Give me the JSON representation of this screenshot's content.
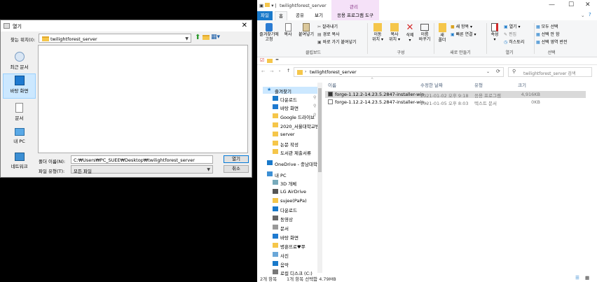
{
  "dialog": {
    "title": "열기",
    "look_in_label": "찾는 위치(I):",
    "look_in_value": "twilightforest_server",
    "places": [
      "최근 문서",
      "바탕 화면",
      "문서",
      "내 PC",
      "네트워크"
    ],
    "filename_label": "폴더 이름(N):",
    "filename_value": "C:₩Users₩PC_SUEE₩Desktop₩twilightforest_server",
    "filetype_label": "파일 유형(T):",
    "filetype_value": "모든 파일",
    "open_button": "열기",
    "cancel_button": "취소"
  },
  "explorer": {
    "title": "twilightforest_server",
    "manage_tab": "관리",
    "tabs": [
      "파일",
      "홈",
      "공유",
      "보기",
      "응용 프로그램 도구"
    ],
    "ribbon": {
      "clipboard": {
        "pin": "즐겨찾기에\n고정",
        "copy": "복사",
        "paste": "붙여넣기",
        "cut": "잘라내기",
        "copy_path": "경로 복사",
        "paste_shortcut": "바로 가기 붙여넣기",
        "group": "클립보드"
      },
      "organize": {
        "move": "이동\n위치 ▾",
        "copy_to": "복사\n위치 ▾",
        "delete": "삭제\n▾",
        "rename": "이름\n바꾸기",
        "group": "구성"
      },
      "new": {
        "folder": "새\n폴더",
        "new_item": "새 항목 ▾",
        "quick_access": "빠른 연결 ▾",
        "group": "새로 만들기"
      },
      "open": {
        "properties": "속성\n▾",
        "open": "열기 ▾",
        "edit": "편집",
        "history": "히스토리",
        "group": "열기"
      },
      "select": {
        "select_all": "모두 선택",
        "select_none": "선택 안 함",
        "invert": "선택 영역 반전",
        "group": "선택"
      }
    },
    "address": "twilightforest_server",
    "search_placeholder": "twilightforest_server 검색",
    "columns": [
      "이름",
      "수정한 날짜",
      "유형",
      "크기"
    ],
    "files": [
      {
        "name": "forge-1.12.2-14.23.5.2847-installer-win",
        "date": "2021-01-02 오후 9:18",
        "type": "응용 프로그램",
        "size": "4,916KB",
        "selected": true
      },
      {
        "name": "forge-1.12.2-14.23.5.2847-installer-win...",
        "date": "2021-01-05 오후 8:03",
        "type": "텍스트 문서",
        "size": "0KB",
        "selected": false
      }
    ],
    "sidebar": [
      {
        "label": "즐겨찾기",
        "kind": "star"
      },
      {
        "label": "다운로드",
        "kind": "down",
        "pin": true
      },
      {
        "label": "바탕 화면",
        "kind": "desk",
        "pin": true
      },
      {
        "label": "Google 드라이브",
        "kind": "folder",
        "pin": true
      },
      {
        "label": "2020_서울대학교병",
        "kind": "folder"
      },
      {
        "label": "server",
        "kind": "folder"
      },
      {
        "label": "논문 작성",
        "kind": "folder"
      },
      {
        "label": "도서관 제출서류",
        "kind": "folder"
      },
      {
        "label": "OneDrive - 충남대학교",
        "kind": "cloud"
      },
      {
        "label": "내 PC",
        "kind": "pc"
      },
      {
        "label": "3D 개체",
        "kind": "cube"
      },
      {
        "label": "LG AirDrive",
        "kind": "phone"
      },
      {
        "label": "sujee(PaPa)",
        "kind": "folder"
      },
      {
        "label": "다운로드",
        "kind": "down"
      },
      {
        "label": "동영상",
        "kind": "video"
      },
      {
        "label": "문서",
        "kind": "doc"
      },
      {
        "label": "바탕 화면",
        "kind": "desk"
      },
      {
        "label": "병훈뜨로♥쭈",
        "kind": "folder"
      },
      {
        "label": "사진",
        "kind": "pic"
      },
      {
        "label": "음악",
        "kind": "music"
      },
      {
        "label": "로컬 디스크 (C:)",
        "kind": "disk"
      }
    ],
    "status_left": "2개 항목",
    "status_right": "1개 항목 선택함 4.79MB",
    "colors": {
      "accent": "#1979ca",
      "manage_tab": "#f5e1f8",
      "selection": "#cce8ff"
    }
  }
}
